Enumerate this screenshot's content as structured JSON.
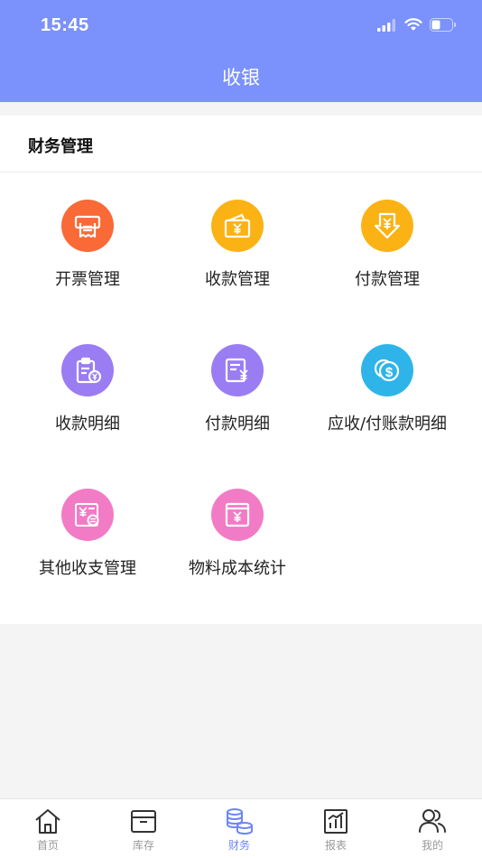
{
  "status_bar": {
    "time": "15:45"
  },
  "header": {
    "title": "收银"
  },
  "section": {
    "title": "财务管理"
  },
  "tiles": [
    {
      "label": "开票管理",
      "icon": "invoice-printer-icon",
      "color": "#f96a37"
    },
    {
      "label": "收款管理",
      "icon": "wallet-yen-icon",
      "color": "#fbb215"
    },
    {
      "label": "付款管理",
      "icon": "yen-download-icon",
      "color": "#fbb215"
    },
    {
      "label": "收款明细",
      "icon": "clipboard-yen-icon",
      "color": "#9a7cf3"
    },
    {
      "label": "付款明细",
      "icon": "document-yen-icon",
      "color": "#9a7cf3"
    },
    {
      "label": "应收/付账款明细",
      "icon": "coin-dollar-icon",
      "color": "#2fb4ea"
    },
    {
      "label": "其他收支管理",
      "icon": "exchange-yen-icon",
      "color": "#f27bc6"
    },
    {
      "label": "物料成本统计",
      "icon": "box-yen-icon",
      "color": "#f27bc6"
    }
  ],
  "tabbar": [
    {
      "label": "首页",
      "icon": "home-icon",
      "active": false
    },
    {
      "label": "库存",
      "icon": "inventory-box-icon",
      "active": false
    },
    {
      "label": "财务",
      "icon": "coins-stack-icon",
      "active": true
    },
    {
      "label": "报表",
      "icon": "report-chart-icon",
      "active": false
    },
    {
      "label": "我的",
      "icon": "users-icon",
      "active": false
    }
  ]
}
